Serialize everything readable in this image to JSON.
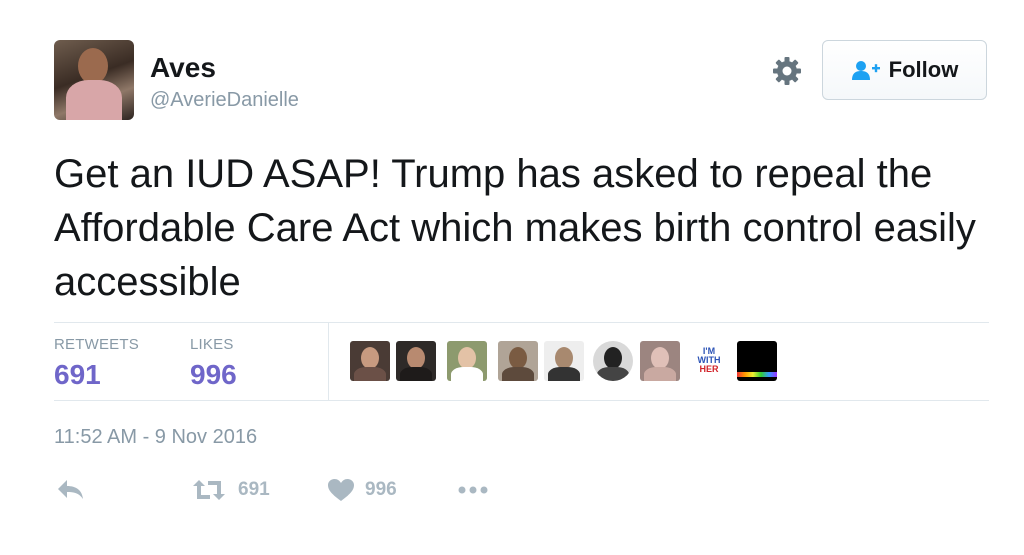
{
  "author": {
    "name": "Aves",
    "handle": "@AverieDanielle"
  },
  "follow_button": {
    "label": "Follow"
  },
  "tweet": {
    "text": "Get an IUD ASAP! Trump has asked to repeal the Affordable Care Act which makes birth control easily accessible",
    "timestamp": "11:52 AM - 9 Nov 2016"
  },
  "stats": {
    "retweets_label": "RETWEETS",
    "retweets_value": "691",
    "likes_label": "LIKES",
    "likes_value": "996"
  },
  "likers_badge": {
    "line1": "I'M",
    "line2": "WITH",
    "line3": "HER"
  },
  "actions": {
    "retweet_count": "691",
    "like_count": "996"
  },
  "icons": {
    "reply": "reply-icon",
    "retweet": "retweet-icon",
    "like": "heart-icon",
    "more": "more-icon",
    "settings": "gear-icon",
    "follow": "add-user-icon"
  },
  "colors": {
    "accent": "#6f66c9",
    "muted": "#8899a6",
    "icon": "#aab8c2",
    "follow_icon": "#1da1f2"
  }
}
